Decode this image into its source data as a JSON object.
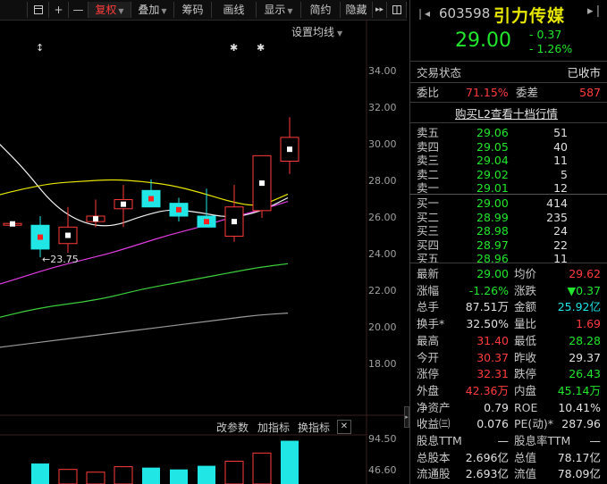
{
  "toolbar": {
    "items": [
      {
        "label": "",
        "icon": "window-copy-icon"
      },
      {
        "label": "+",
        "icon": "plus-icon"
      },
      {
        "label": "—",
        "icon": "minus-icon"
      },
      {
        "label": "复权",
        "dropdown": true,
        "active": true
      },
      {
        "label": "叠加",
        "dropdown": true
      },
      {
        "label": "筹码"
      },
      {
        "label": "画线"
      },
      {
        "label": "显示",
        "dropdown": true
      },
      {
        "label": "简约"
      },
      {
        "label": "隐藏"
      },
      {
        "label": "▸▸",
        "icon": "expand-right-icon"
      }
    ]
  },
  "chart": {
    "ma_setting": "设置均线",
    "low_marker": "←23.75",
    "star_marks": [
      "↕",
      "✱",
      "✱"
    ],
    "price_axis": [
      "34.00",
      "32.00",
      "30.00",
      "28.00",
      "26.00",
      "24.00",
      "22.00",
      "20.00",
      "18.00"
    ],
    "indicator_toolbar": {
      "change_params": "改参数",
      "add_indicator": "加指标",
      "switch_indicator": "换指标",
      "close": "✕"
    },
    "volume_axis": [
      "94.50",
      "46.60"
    ]
  },
  "chart_data": {
    "type": "candlestick",
    "y_range": [
      17,
      35
    ],
    "candles": [
      {
        "o": 25.55,
        "h": 25.7,
        "l": 25.45,
        "c": 25.6
      },
      {
        "o": 25.5,
        "h": 26.0,
        "l": 23.75,
        "c": 24.2
      },
      {
        "o": 24.5,
        "h": 26.5,
        "l": 24.0,
        "c": 25.4
      },
      {
        "o": 25.7,
        "h": 26.9,
        "l": 25.4,
        "c": 26.0
      },
      {
        "o": 26.4,
        "h": 27.7,
        "l": 25.4,
        "c": 26.9
      },
      {
        "o": 27.4,
        "h": 28.0,
        "l": 26.5,
        "c": 26.5
      },
      {
        "o": 26.7,
        "h": 27.0,
        "l": 25.7,
        "c": 26.0
      },
      {
        "o": 26.0,
        "h": 27.5,
        "l": 25.6,
        "c": 25.4
      },
      {
        "o": 24.9,
        "h": 27.7,
        "l": 24.6,
        "c": 26.5
      },
      {
        "o": 26.3,
        "h": 29.3,
        "l": 25.9,
        "c": 29.3
      },
      {
        "o": 29.0,
        "h": 31.4,
        "l": 28.3,
        "c": 30.3
      }
    ],
    "ma_lines": [
      {
        "color": "#f2f2f2",
        "points": [
          [
            0,
            30.2
          ],
          [
            1,
            28.6
          ],
          [
            2,
            26.6
          ],
          [
            3,
            25.6
          ],
          [
            4,
            25.4
          ],
          [
            5,
            26.0
          ],
          [
            6,
            26.4
          ],
          [
            7,
            26.2
          ],
          [
            8,
            25.9
          ],
          [
            9,
            26.2
          ],
          [
            10,
            27.0
          ]
        ]
      },
      {
        "color": "#e6e600",
        "points": [
          [
            0,
            27.1
          ],
          [
            1,
            27.5
          ],
          [
            2,
            27.8
          ],
          [
            3,
            27.9
          ],
          [
            4,
            28.0
          ],
          [
            5,
            27.9
          ],
          [
            6,
            27.7
          ],
          [
            7,
            27.3
          ],
          [
            8,
            26.8
          ],
          [
            9,
            26.5
          ],
          [
            10,
            27.2
          ]
        ]
      },
      {
        "color": "#e03ce0",
        "points": [
          [
            0,
            22.2
          ],
          [
            1,
            22.7
          ],
          [
            2,
            23.2
          ],
          [
            3,
            23.6
          ],
          [
            4,
            24.0
          ],
          [
            5,
            24.5
          ],
          [
            6,
            25.0
          ],
          [
            7,
            25.4
          ],
          [
            8,
            25.9
          ],
          [
            9,
            26.3
          ],
          [
            10,
            26.8
          ]
        ]
      },
      {
        "color": "#3ccf3c",
        "points": [
          [
            0,
            20.4
          ],
          [
            1,
            20.8
          ],
          [
            2,
            21.1
          ],
          [
            3,
            21.3
          ],
          [
            4,
            21.6
          ],
          [
            5,
            22.0
          ],
          [
            6,
            22.3
          ],
          [
            7,
            22.6
          ],
          [
            8,
            22.9
          ],
          [
            9,
            23.2
          ],
          [
            10,
            23.4
          ]
        ]
      },
      {
        "color": "#9a9a9a",
        "points": [
          [
            0,
            18.8
          ],
          [
            1,
            19.0
          ],
          [
            2,
            19.2
          ],
          [
            3,
            19.4
          ],
          [
            4,
            19.6
          ],
          [
            5,
            19.8
          ],
          [
            6,
            20.0
          ],
          [
            7,
            20.2
          ],
          [
            8,
            20.4
          ],
          [
            9,
            20.6
          ],
          [
            10,
            20.7
          ]
        ]
      }
    ],
    "volume_range": [
      0,
      100
    ],
    "volume": [
      {
        "v": 0,
        "up": false
      },
      {
        "v": 45,
        "up": false
      },
      {
        "v": 32,
        "up": true
      },
      {
        "v": 26,
        "up": true
      },
      {
        "v": 38,
        "up": true
      },
      {
        "v": 36,
        "up": false
      },
      {
        "v": 32,
        "up": false
      },
      {
        "v": 40,
        "up": false
      },
      {
        "v": 50,
        "up": true
      },
      {
        "v": 68,
        "up": true
      },
      {
        "v": 95,
        "up": false
      }
    ]
  },
  "quote": {
    "code": "603598",
    "name": "引力传媒",
    "price": "29.00",
    "change": "- 0.37",
    "change_pct": "- 1.26%",
    "state_label": "交易状态",
    "state_value": "已收市",
    "ratio_label": "委比",
    "ratio_value": "71.15%",
    "diff_label": "委差",
    "diff_value": "587",
    "l2_link": "购买L2查看十档行情"
  },
  "order_book": {
    "sells": [
      {
        "label": "卖五",
        "price": "29.06",
        "vol": "51"
      },
      {
        "label": "卖四",
        "price": "29.05",
        "vol": "40"
      },
      {
        "label": "卖三",
        "price": "29.04",
        "vol": "11"
      },
      {
        "label": "卖二",
        "price": "29.02",
        "vol": "5"
      },
      {
        "label": "卖一",
        "price": "29.01",
        "vol": "12"
      }
    ],
    "buys": [
      {
        "label": "买一",
        "price": "29.00",
        "vol": "414"
      },
      {
        "label": "买二",
        "price": "28.99",
        "vol": "235"
      },
      {
        "label": "买三",
        "price": "28.98",
        "vol": "24"
      },
      {
        "label": "买四",
        "price": "28.97",
        "vol": "22"
      },
      {
        "label": "买五",
        "price": "28.96",
        "vol": "11"
      }
    ]
  },
  "stats": [
    {
      "l1": "最新",
      "v1": "29.00",
      "c1": "green",
      "l2": "均价",
      "v2": "29.62",
      "c2": "red"
    },
    {
      "l1": "涨幅",
      "v1": "-1.26%",
      "c1": "green",
      "l2": "涨跌",
      "v2": "▼0.37",
      "c2": "green"
    },
    {
      "l1": "总手",
      "v1": "87.51万",
      "c1": "white",
      "l2": "金额",
      "v2": "25.92亿",
      "c2": "cyan"
    },
    {
      "l1": "换手*",
      "v1": "32.50%",
      "c1": "white",
      "l2": "量比",
      "v2": "1.69",
      "c2": "red"
    },
    {
      "l1": "最高",
      "v1": "31.40",
      "c1": "red",
      "l2": "最低",
      "v2": "28.28",
      "c2": "green"
    },
    {
      "l1": "今开",
      "v1": "30.37",
      "c1": "red",
      "l2": "昨收",
      "v2": "29.37",
      "c2": "white"
    },
    {
      "l1": "涨停",
      "v1": "32.31",
      "c1": "red",
      "l2": "跌停",
      "v2": "26.43",
      "c2": "green"
    },
    {
      "l1": "外盘",
      "v1": "42.36万",
      "c1": "red",
      "l2": "内盘",
      "v2": "45.14万",
      "c2": "green"
    },
    {
      "l1": "净资产",
      "v1": "0.79",
      "c1": "white",
      "l2": "ROE",
      "v2": "10.41%",
      "c2": "white"
    },
    {
      "l1": "收益㈢",
      "v1": "0.076",
      "c1": "white",
      "l2": "PE(动)*",
      "v2": "287.96",
      "c2": "white"
    },
    {
      "l1": "股息TTM",
      "v1": "—",
      "c1": "white",
      "l2": "股息率TTM",
      "v2": "—",
      "c2": "white"
    },
    {
      "l1": "总股本",
      "v1": "2.696亿",
      "c1": "white",
      "l2": "总值",
      "v2": "78.17亿",
      "c2": "white"
    },
    {
      "l1": "流通股",
      "v1": "2.693亿",
      "c1": "white",
      "l2": "流值",
      "v2": "78.09亿",
      "c2": "white"
    }
  ],
  "colors": {
    "up": "#ff3b3b",
    "down": "#21e6e6",
    "green": "#21e62b",
    "cyan": "#21e6e6",
    "text": "#c8c8c8"
  }
}
